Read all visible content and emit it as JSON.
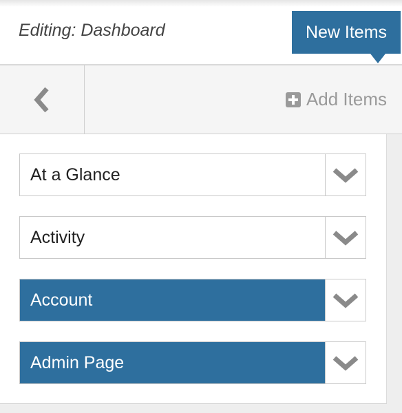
{
  "header": {
    "title": "Editing: Dashboard"
  },
  "tooltip": {
    "text": "New Items"
  },
  "toolbar": {
    "back_icon": "chevron-left-icon",
    "add_items_icon": "plus-square-icon",
    "add_items_label": "Add Items"
  },
  "menu": {
    "items": [
      {
        "label": "At a Glance",
        "active": false
      },
      {
        "label": "Activity",
        "active": false
      },
      {
        "label": "Account",
        "active": true
      },
      {
        "label": "Admin Page",
        "active": true
      }
    ],
    "toggle_icon": "chevron-down-icon"
  },
  "colors": {
    "accent": "#2e6f9e",
    "icon_gray": "#9a9a9a",
    "text": "#222222"
  }
}
